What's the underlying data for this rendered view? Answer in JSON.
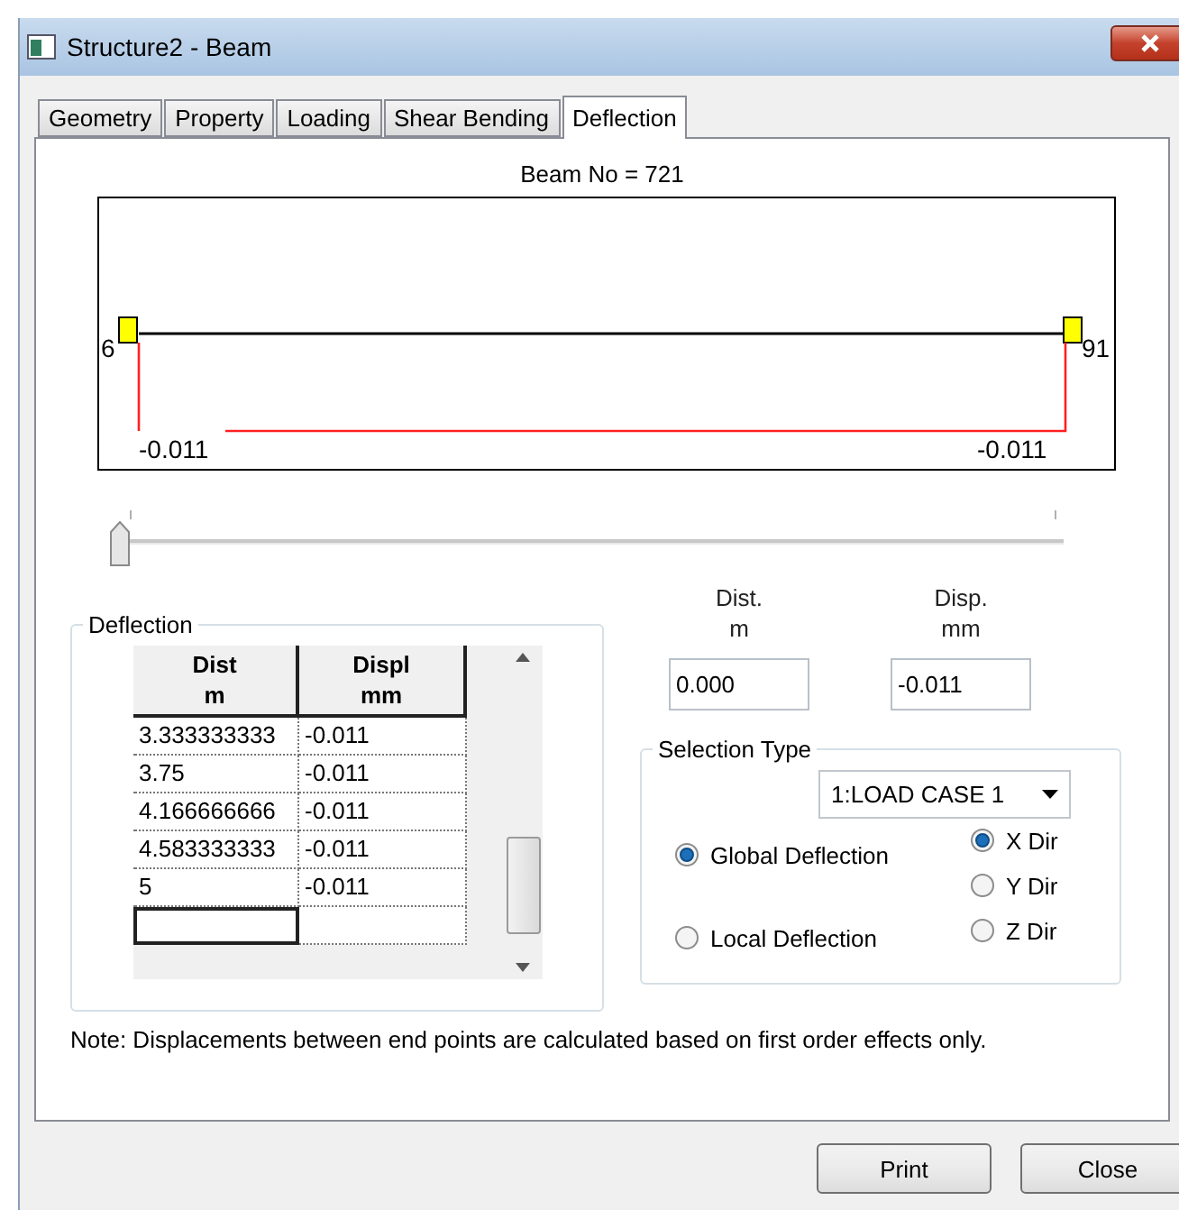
{
  "window": {
    "title": "Structure2 - Beam"
  },
  "tabs": [
    {
      "label": "Geometry",
      "selected": false
    },
    {
      "label": "Property",
      "selected": false
    },
    {
      "label": "Loading",
      "selected": false
    },
    {
      "label": "Shear Bending",
      "selected": false
    },
    {
      "label": "Deflection",
      "selected": true
    }
  ],
  "beam_label": "Beam No = 721",
  "diagram": {
    "start_node": "6",
    "end_node": "91",
    "start_value": "-0.011",
    "end_value": "-0.011"
  },
  "position_slider": {
    "level": 0
  },
  "deflection_group": {
    "title": "Deflection",
    "columns": [
      [
        "Dist",
        "m"
      ],
      [
        "Displ",
        "mm"
      ]
    ],
    "rows": [
      {
        "dist": "3.333333333",
        "displ": "-0.011"
      },
      {
        "dist": "3.75",
        "displ": "-0.011"
      },
      {
        "dist": "4.166666666",
        "displ": "-0.011"
      },
      {
        "dist": "4.583333333",
        "displ": "-0.011"
      },
      {
        "dist": "5",
        "displ": "-0.011"
      }
    ]
  },
  "readout": [
    {
      "label": [
        "Dist.",
        "m"
      ],
      "value": "0.000"
    },
    {
      "label": [
        "Disp.",
        "mm"
      ],
      "value": "-0.011"
    }
  ],
  "selection_type": {
    "title": "Selection Type",
    "load_case": "1:LOAD CASE 1",
    "modes": [
      {
        "label": "Global Deflection",
        "selected": true
      },
      {
        "label": "Local Deflection",
        "selected": false
      }
    ],
    "directions": [
      {
        "label": "X Dir",
        "selected": true
      },
      {
        "label": "Y Dir",
        "selected": false
      },
      {
        "label": "Z Dir",
        "selected": false
      }
    ]
  },
  "note": "Note: Displacements between end points are calculated based on first order effects only.",
  "buttons": [
    "Print",
    "Close"
  ]
}
